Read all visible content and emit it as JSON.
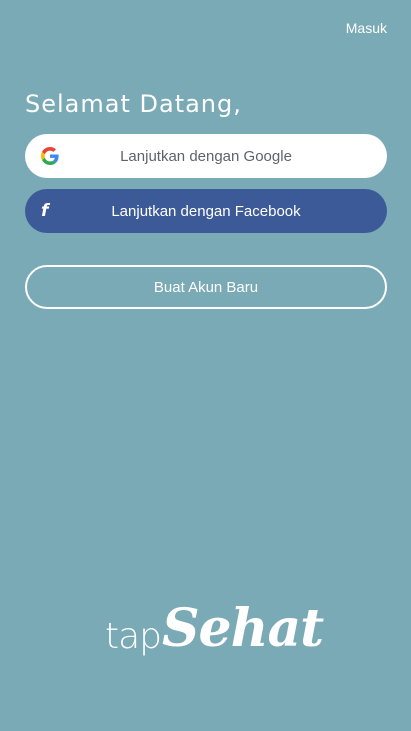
{
  "header": {
    "login_label": "Masuk"
  },
  "welcome": {
    "title": "Selamat Datang,"
  },
  "buttons": {
    "google_label": "Lanjutkan dengan Google",
    "facebook_label": "Lanjutkan dengan Facebook",
    "register_label": "Buat Akun Baru"
  },
  "icons": {
    "google": "google-g-icon",
    "facebook": "facebook-f-icon"
  },
  "logo": {
    "part1": "tap",
    "part2": "Sehat"
  },
  "colors": {
    "background": "#79aab6",
    "facebook": "#3d5a98",
    "white": "#ffffff"
  }
}
